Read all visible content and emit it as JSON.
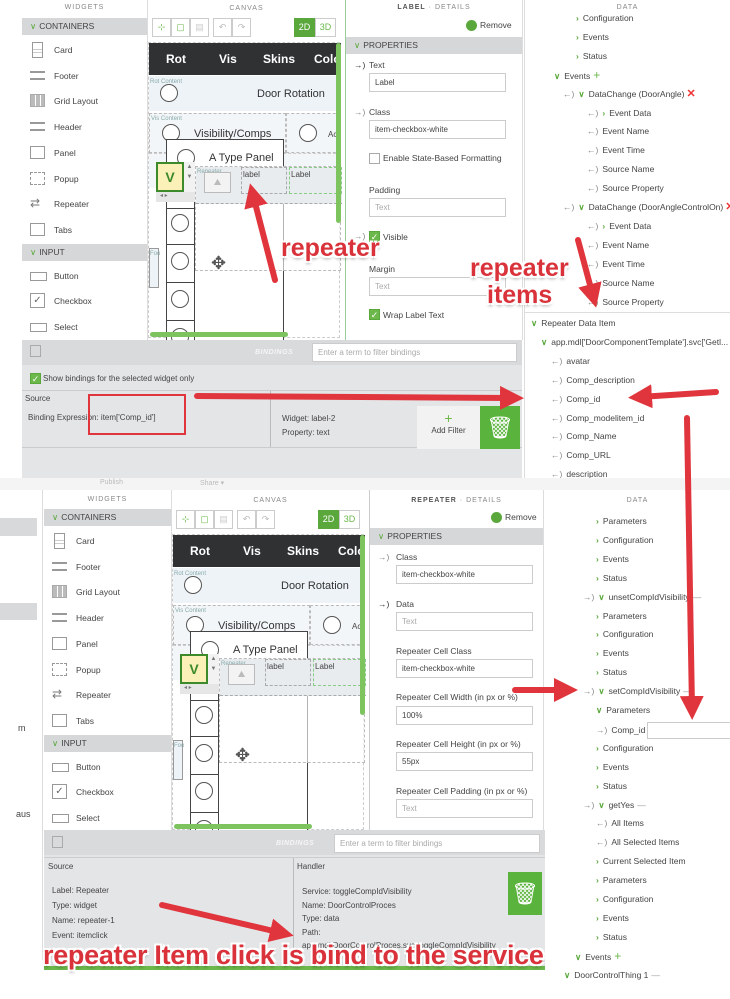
{
  "colors": {
    "accent_green": "#5aa83c",
    "annotation_red": "#d9323a",
    "nav_dark": "#2f3133",
    "panel_gray": "#d9dadc"
  },
  "widgets": {
    "title": "WIDGETS",
    "sections": [
      {
        "label": "CONTAINERS",
        "items": [
          {
            "label": "Card",
            "icon": "card"
          },
          {
            "label": "Footer",
            "icon": "footer"
          },
          {
            "label": "Grid Layout",
            "icon": "grid"
          },
          {
            "label": "Header",
            "icon": "header"
          },
          {
            "label": "Panel",
            "icon": "panel"
          },
          {
            "label": "Popup",
            "icon": "popup"
          },
          {
            "label": "Repeater",
            "icon": "repeater"
          },
          {
            "label": "Tabs",
            "icon": "tabs"
          }
        ]
      },
      {
        "label": "INPUT",
        "items": [
          {
            "label": "Button",
            "icon": "button"
          },
          {
            "label": "Checkbox",
            "icon": "checkbox"
          },
          {
            "label": "Select",
            "icon": "select"
          }
        ]
      }
    ]
  },
  "canvas": {
    "title": "CANVAS",
    "toolbar": {
      "mode_2d": "2D",
      "mode_3d": "3D",
      "selected_mode": "2D"
    },
    "nav": [
      "Rot",
      "Vis",
      "Skins",
      "Colo"
    ],
    "rot_content": "Rot Content",
    "door_rotation": "Door Rotation",
    "vis_content": "Vis Content",
    "visibility": "Visibility/Comps",
    "right_label": "Ac",
    "type_panel": "A Type Panel",
    "selected_widget": "V",
    "repeater_tag": "Repeater",
    "cell_label_1": "label",
    "cell_label_2": "Label",
    "footer_tag": "Foo"
  },
  "top": {
    "details": {
      "type": "LABEL",
      "suffix": "DETAILS",
      "remove": "Remove",
      "properties": "PROPERTIES",
      "text_label": "Text",
      "text_value": "Label",
      "class_label": "Class",
      "class_value": "item-checkbox-white",
      "state_formatting": "Enable State-Based Formatting",
      "padding_label": "Padding",
      "padding_placeholder": "Text",
      "visible_label": "Visible",
      "margin_label": "Margin",
      "margin_placeholder": "Text",
      "wrap_label": "Wrap Label Text"
    },
    "data_title": "DATA",
    "data_tree": [
      {
        "label": "Configuration",
        "depth": 5,
        "chevron": "right"
      },
      {
        "label": "Events",
        "depth": 5,
        "chevron": "right"
      },
      {
        "label": "Status",
        "depth": 5,
        "chevron": "right"
      },
      {
        "label": "Events",
        "depth": 3,
        "chevron": "down",
        "suffix": "plus"
      },
      {
        "label": "DataChange (DoorAngle)",
        "depth": 4,
        "arrow": "in",
        "chevron": "down",
        "suffix": "remove"
      },
      {
        "label": "Event Data",
        "depth": 6,
        "arrow": "in",
        "chevron": "right"
      },
      {
        "label": "Event Name",
        "depth": 6,
        "arrow": "in"
      },
      {
        "label": "Event Time",
        "depth": 6,
        "arrow": "in"
      },
      {
        "label": "Source Name",
        "depth": 6,
        "arrow": "in"
      },
      {
        "label": "Source Property",
        "depth": 6,
        "arrow": "in"
      },
      {
        "label": "DataChange (DoorAngleControlOn)",
        "depth": 4,
        "arrow": "in",
        "chevron": "down",
        "suffix": "remove"
      },
      {
        "label": "Event Data",
        "depth": 6,
        "arrow": "in",
        "chevron": "right"
      },
      {
        "label": "Event Name",
        "depth": 6,
        "arrow": "in"
      },
      {
        "label": "Event Time",
        "depth": 6,
        "arrow": "in"
      },
      {
        "label": "Source Name",
        "depth": 6,
        "arrow": "in"
      },
      {
        "label": "Source Property",
        "depth": 6,
        "arrow": "in"
      }
    ],
    "repeater_tree": [
      {
        "label": "Repeater Data Item",
        "depth": 0,
        "chevron": "down"
      },
      {
        "label": "app.mdl['DoorComponentTemplate'].svc['Getl...",
        "depth": 1,
        "chevron": "down"
      },
      {
        "label": "avatar",
        "depth": 2,
        "arrow": "in"
      },
      {
        "label": "Comp_description",
        "depth": 2,
        "arrow": "in"
      },
      {
        "label": "Comp_id",
        "depth": 2,
        "arrow": "in"
      },
      {
        "label": "Comp_modelitem_id",
        "depth": 2,
        "arrow": "in"
      },
      {
        "label": "Comp_Name",
        "depth": 2,
        "arrow": "in"
      },
      {
        "label": "Comp_URL",
        "depth": 2,
        "arrow": "in"
      },
      {
        "label": "description",
        "depth": 2,
        "arrow": "in"
      }
    ],
    "bindings": {
      "title": "BINDINGS",
      "filter_placeholder": "Enter a term to filter bindings",
      "show_selected_only": "Show bindings for the selected widget only",
      "show_selected_checked": true,
      "source_header": "Source",
      "expression": "Binding Expression: item['Comp_id']",
      "target_widget": "Widget: label-2",
      "target_property": "Property: text",
      "add_filter": "Add Filter"
    },
    "footer": {
      "publish": "Publish",
      "share": "Share ▾"
    }
  },
  "bottom": {
    "sidebar_fragments": [
      "m",
      "aus"
    ],
    "details": {
      "type": "REPEATER",
      "suffix": "DETAILS",
      "remove": "Remove",
      "properties": "PROPERTIES",
      "class_label": "Class",
      "class_value": "item-checkbox-white",
      "data_label": "Data",
      "data_placeholder": "Text",
      "cell_class_label": "Repeater Cell Class",
      "cell_class_value": "item-checkbox-white",
      "cell_width_label": "Repeater Cell Width (in px or %)",
      "cell_width_value": "100%",
      "cell_height_label": "Repeater Cell Height (in px or %)",
      "cell_height_value": "55px",
      "cell_padding_label": "Repeater Cell Padding (in px or %)",
      "cell_padding_placeholder": "Text"
    },
    "data_title": "DATA",
    "data_tree": [
      {
        "label": "Parameters",
        "depth": 3,
        "chevron": "right"
      },
      {
        "label": "Configuration",
        "depth": 3,
        "chevron": "right"
      },
      {
        "label": "Events",
        "depth": 3,
        "chevron": "right"
      },
      {
        "label": "Status",
        "depth": 3,
        "chevron": "right"
      },
      {
        "label": "unsetCompIdVisibility",
        "depth": 2,
        "arrow": "out",
        "chevron": "down",
        "suffix": "minus"
      },
      {
        "label": "Parameters",
        "depth": 3,
        "chevron": "right"
      },
      {
        "label": "Configuration",
        "depth": 3,
        "chevron": "right"
      },
      {
        "label": "Events",
        "depth": 3,
        "chevron": "right"
      },
      {
        "label": "Status",
        "depth": 3,
        "chevron": "right"
      },
      {
        "label": "setCompIdVisibility",
        "depth": 2,
        "arrow": "out",
        "chevron": "down",
        "suffix": "minus"
      },
      {
        "label": "Parameters",
        "depth": 3,
        "chevron": "down"
      },
      {
        "label": "Comp_id",
        "depth": 3,
        "arrow": "out",
        "suffix": "input"
      },
      {
        "label": "Configuration",
        "depth": 3,
        "chevron": "right"
      },
      {
        "label": "Events",
        "depth": 3,
        "chevron": "right"
      },
      {
        "label": "Status",
        "depth": 3,
        "chevron": "right"
      },
      {
        "label": "getYes",
        "depth": 2,
        "arrow": "out",
        "chevron": "down",
        "suffix": "minus"
      },
      {
        "label": "All Items",
        "depth": 3,
        "arrow": "in"
      },
      {
        "label": "All Selected Items",
        "depth": 3,
        "arrow": "in"
      },
      {
        "label": "Current Selected Item",
        "depth": 3,
        "chevron": "right"
      },
      {
        "label": "Parameters",
        "depth": 3,
        "chevron": "right"
      },
      {
        "label": "Configuration",
        "depth": 3,
        "chevron": "right"
      },
      {
        "label": "Events",
        "depth": 3,
        "chevron": "right"
      },
      {
        "label": "Status",
        "depth": 3,
        "chevron": "right"
      },
      {
        "label": "Events",
        "depth": 1,
        "chevron": "down",
        "suffix": "plus"
      },
      {
        "label": "DoorControlThing 1",
        "depth": 0,
        "chevron": "down",
        "suffix": "minus"
      }
    ],
    "bindings": {
      "title": "BINDINGS",
      "filter_placeholder": "Enter a term to filter bindings",
      "source_header": "Source",
      "handler_header": "Handler",
      "source_lines": [
        "Label: Repeater",
        "Type: widget",
        "Name: repeater-1",
        "Event: itemclick"
      ],
      "handler_lines": [
        "Service: toggleCompIdVisibility",
        "Name: DoorControlProces",
        "Type: data",
        "Path:",
        "app.mdl.DoorControlProces.svc.toggleCompIdVisibility"
      ]
    }
  },
  "annotations": {
    "repeater": "repeater",
    "repeater_items_1": "repeater",
    "repeater_items_2": "items",
    "service_note": "repeater Item click is bind to the service"
  }
}
